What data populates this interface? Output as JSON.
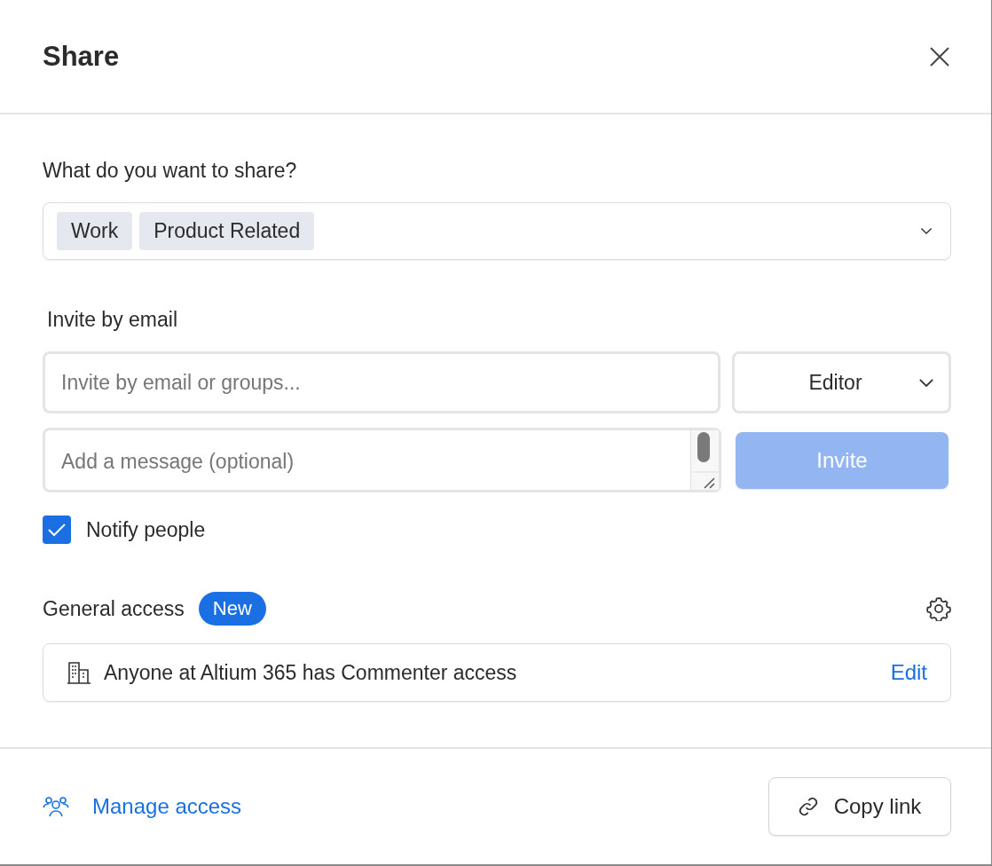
{
  "dialog": {
    "title": "Share"
  },
  "share_section": {
    "label": "What do you want to share?",
    "tags": [
      "Work",
      "Product Related"
    ]
  },
  "invite": {
    "label": "Invite by email",
    "email_placeholder": "Invite by email or groups...",
    "role": "Editor",
    "message_placeholder": "Add a message (optional)",
    "invite_button": {
      "label": "Invite",
      "disabled": true
    }
  },
  "notify": {
    "label": "Notify people",
    "checked": true
  },
  "general_access": {
    "label": "General access",
    "badge": "New",
    "description": "Anyone at Altium 365 has Commenter access",
    "edit_label": "Edit"
  },
  "footer": {
    "manage_access": "Manage access",
    "copy_link": "Copy link"
  }
}
